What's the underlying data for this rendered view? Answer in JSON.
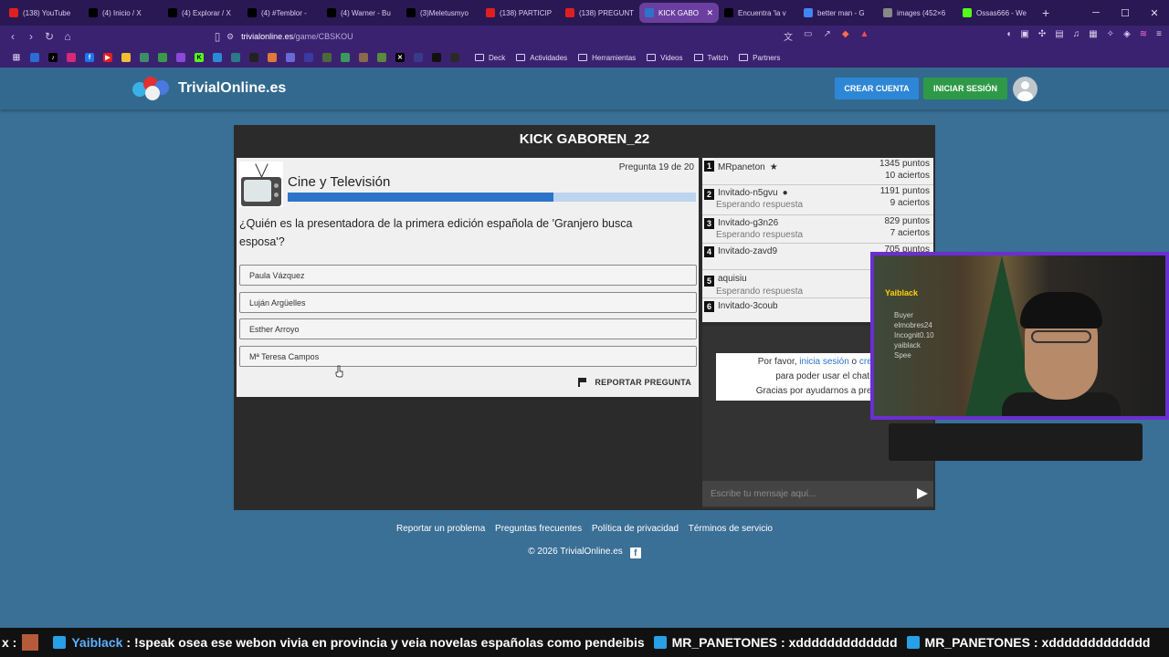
{
  "browser": {
    "tabs": [
      {
        "label": "(138) YouTube",
        "icon": "youtube-icon",
        "color": "#e02020"
      },
      {
        "label": "(4) Inicio / X",
        "icon": "x-icon",
        "color": "#000000"
      },
      {
        "label": "(4) Explorar / X",
        "icon": "x-icon",
        "color": "#000000"
      },
      {
        "label": "(4) #Temblor -",
        "icon": "x-icon",
        "color": "#000000"
      },
      {
        "label": "(4) Warner - Bu",
        "icon": "x-icon",
        "color": "#000000"
      },
      {
        "label": "(3)Meletusmyo",
        "icon": "tiktok-icon",
        "color": "#000000"
      },
      {
        "label": "(138) PARTICIP",
        "icon": "youtube-icon",
        "color": "#e02020"
      },
      {
        "label": "(138) PREGUNT",
        "icon": "youtube-icon",
        "color": "#e02020"
      },
      {
        "label": "KICK GABO",
        "icon": "trivial-icon",
        "color": "#2c74c9",
        "active": true
      },
      {
        "label": "Encuentra 'la v",
        "icon": "tiktok-icon",
        "color": "#000000"
      },
      {
        "label": "better man - G",
        "icon": "google-icon",
        "color": "#4285f4"
      },
      {
        "label": "images (452×6",
        "icon": "image-icon",
        "color": "#888888"
      },
      {
        "label": "Ossas666 - We",
        "icon": "kick-icon",
        "color": "#53fc18"
      }
    ],
    "url_host": "trivialonline.es",
    "url_path": "/game/CBSKOU",
    "bookmarks": [
      "Deck",
      "Actividades",
      "Herramientas",
      "Videos",
      "Twitch",
      "Partners"
    ]
  },
  "header": {
    "brand": "TrivialOnline.es",
    "create_account": "CREAR CUENTA",
    "login": "INICIAR SESIÓN"
  },
  "game": {
    "title": "KICK GABOREN_22",
    "question_counter": "Pregunta 19 de 20",
    "progress": 0.65,
    "category": "Cine y Televisión",
    "question": "¿Quién es la presentadora de la primera edición española de 'Granjero busca esposa'?",
    "answers": [
      "Paula Vázquez",
      "Luján Argüelles",
      "Esther Arroyo",
      "Mª Teresa Campos"
    ],
    "report": "REPORTAR PREGUNTA"
  },
  "scoreboard": [
    {
      "rank": "1",
      "name": "MRpaneton",
      "icon": "star-icon",
      "status": "",
      "points": "1345 puntos",
      "correct": "10 aciertos"
    },
    {
      "rank": "2",
      "name": "Invitado-n5gvu",
      "icon": "user-icon",
      "status": "Esperando respuesta",
      "points": "1191 puntos",
      "correct": "9 aciertos"
    },
    {
      "rank": "3",
      "name": "Invitado-g3n26",
      "icon": "",
      "status": "Esperando respuesta",
      "points": "829 puntos",
      "correct": "7 aciertos"
    },
    {
      "rank": "4",
      "name": "Invitado-zavd9",
      "icon": "",
      "status": "",
      "points": "705 puntos",
      "correct": ""
    },
    {
      "rank": "5",
      "name": "aquisiu",
      "icon": "",
      "status": "Esperando respuesta",
      "points": "",
      "correct": ""
    },
    {
      "rank": "6",
      "name": "Invitado-3coub",
      "icon": "",
      "status": "",
      "points": "",
      "correct": ""
    }
  ],
  "chat": {
    "msg_part1": "Por favor, ",
    "msg_link1": "inicia sesión",
    "msg_part2": " o ",
    "msg_link2": "crea un",
    "msg_line2": "para poder usar el chat.",
    "msg_line3": "Gracias por ayudarnos a prevenir",
    "input_placeholder": "Escribe tu mensaje aquí..."
  },
  "footer": {
    "links": [
      "Reportar un problema",
      "Preguntas frecuentes",
      "Política de privacidad",
      "Términos de servicio"
    ],
    "copyright": "© 2026 TrivialOnline.es"
  },
  "stream": {
    "overlay_text": "Yaiblack",
    "ticker": [
      {
        "user": "x :",
        "message": ""
      },
      {
        "user": "Yaiblack",
        "message": ": !speak osea ese webon vivia en provincia y veia novelas españolas como pendeibis"
      },
      {
        "user": "MR_PANETONES",
        "message": ": xddddddddddddd"
      },
      {
        "user": "MR_PANETONES",
        "message": ": xddddddddddddd"
      }
    ],
    "webcam_board_lines": [
      "Buyer",
      "elmobres24",
      "Incognit0.10",
      "yaiblack",
      "Spee"
    ]
  },
  "colors": {
    "page_bg": "#3a6f96",
    "header_bg": "#33698f",
    "create_btn": "#2e86d6",
    "login_btn": "#2e9a47",
    "progress_fill": "#2c74c9",
    "progress_track": "#bcd4ee",
    "webcam_border": "#6a2fd0"
  }
}
